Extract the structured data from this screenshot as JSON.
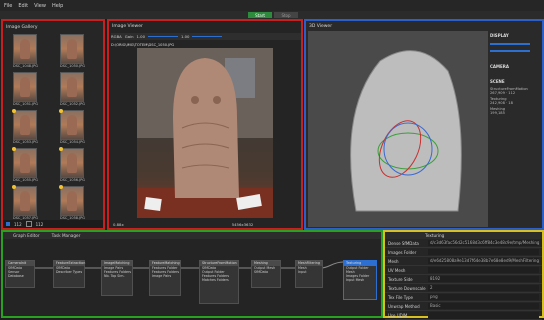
{
  "menu": [
    "File",
    "Edit",
    "View",
    "Help"
  ],
  "toolbar": {
    "start_label": "Start",
    "stop_label": "Stop"
  },
  "gallery": {
    "title": "Image Gallery",
    "thumbs": [
      "DSC_1048.JPG",
      "DSC_1050.JPG",
      "DSC_1051.JPG",
      "DSC_1052.JPG",
      "DSC_1053.JPG",
      "DSC_1054.JPG",
      "DSC_1055.JPG",
      "DSC_1056.JPG",
      "DSC_1057.JPG",
      "DSC_1058.JPG"
    ],
    "count": "112",
    "count2": "112"
  },
  "viewer": {
    "title": "Image Viewer",
    "filename": "D:\\ORIG\\IMG\\TOTEM\\DSC_1050.JPG",
    "gain_label": "Gain",
    "gain_value": "1.00",
    "gamma_value": "1.00",
    "mode": "RGBA",
    "zoom": "0.88x",
    "resolution": "5456x3632"
  },
  "d3": {
    "title": "3D Viewer",
    "display_label": "DISPLAY",
    "camera_label": "CAMERA",
    "scene_label": "SCENE",
    "sfm_label": "StructureFromMotion",
    "sfm_stats": "267,909 · 112",
    "texturing_label": "Texturing",
    "texturing_stats": "242,908 · 18",
    "meshing_label": "Meshing",
    "meshing_stats": "199,185"
  },
  "graph": {
    "tab1": "Graph Editor",
    "tab2": "Task Manager",
    "nodes": [
      {
        "title": "CameraInit",
        "rows": [
          "SfMData",
          "Sensor Database",
          "Color Profile Database"
        ]
      },
      {
        "title": "FeatureExtraction",
        "rows": [
          "SfMData",
          "Feature Folder",
          "Describer Types"
        ]
      },
      {
        "title": "ImageMatching",
        "rows": [
          "Image Pairs",
          "SfMData",
          "Features Folders",
          "Nb. Top Sim.",
          "Min. Nb. Images"
        ]
      },
      {
        "title": "FeatureMatching",
        "rows": [
          "Features Folder",
          "SfMData",
          "Features Folders",
          "Image Pairs"
        ]
      },
      {
        "title": "StructureFromMotion",
        "rows": [
          "SfMData",
          "Output Folder",
          "SfMData",
          "Features Folders",
          "Matches Folders",
          "Describer Types"
        ]
      },
      {
        "title": "Meshing",
        "rows": [
          "Output Mesh",
          "SfMData",
          "Depth Maps Folder"
        ]
      },
      {
        "title": "MeshFiltering",
        "rows": [
          "Mesh",
          "Input"
        ]
      },
      {
        "title": "Texturing",
        "rows": [
          "Output Folder",
          "Mesh",
          "Images Folder",
          "Input Mesh",
          "Denser SfMData"
        ]
      }
    ]
  },
  "attributes": {
    "title": "Texturing",
    "rows": [
      {
        "k": "Dense SfMData",
        "v": "d/c3d63fac56d2c5168d3c6ff84c3e48c9e/tmp/Meshing/Dense.abc"
      },
      {
        "k": "Images Folder",
        "v": ""
      },
      {
        "k": "Mesh",
        "v": "d/e6d25808a9e13d7f64e38b7e68e8ed9/MeshFiltering/filtered.obj"
      },
      {
        "k": "UV Mesh",
        "v": ""
      },
      {
        "k": "Texture Side",
        "v": "8192"
      },
      {
        "k": "Texture Downscale",
        "v": "2"
      },
      {
        "k": "Tex File Type",
        "v": "png"
      },
      {
        "k": "Unwrap Method",
        "v": "Basic"
      },
      {
        "k": "Use UDIM",
        "v": ""
      }
    ]
  }
}
